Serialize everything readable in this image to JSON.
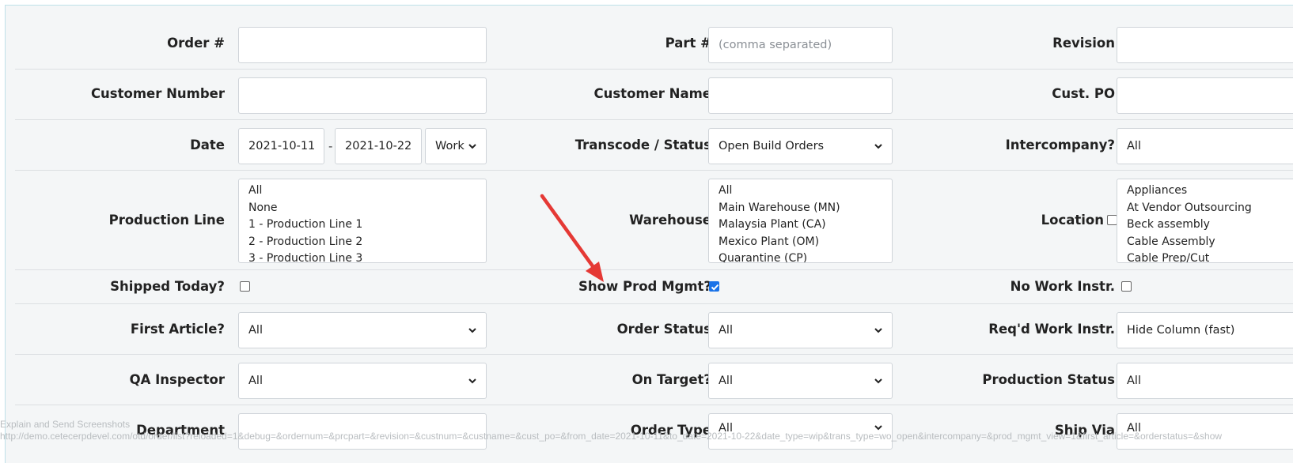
{
  "row1": {
    "order_label": "Order #",
    "part_label": "Part #",
    "part_placeholder": "(comma separated)",
    "revision_label": "Revision"
  },
  "row2": {
    "custnum_label": "Customer Number",
    "custname_label": "Customer Name",
    "custpo_label": "Cust. PO"
  },
  "row3": {
    "date_label": "Date",
    "from_date": "2021-10-11",
    "separator": "-",
    "to_date": "2021-10-22",
    "date_type": "Work",
    "transcode_label": "Transcode / Status",
    "transcode_value": "Open Build Orders",
    "intercompany_label": "Intercompany?",
    "intercompany_value": "All"
  },
  "row4": {
    "prodline_label": "Production Line",
    "prodline_options": [
      "All",
      "None",
      "1 - Production Line 1",
      "2 - Production Line 2",
      "3 - Production Line 3"
    ],
    "warehouse_label": "Warehouse",
    "warehouse_options": [
      "All",
      "Main Warehouse (MN)",
      "Malaysia Plant (CA)",
      "Mexico Plant (OM)",
      "Quarantine (CP)"
    ],
    "location_label": "Location",
    "location_options": [
      "Appliances",
      "At Vendor Outsourcing",
      "Beck assembly",
      "Cable Assembly",
      "Cable Prep/Cut"
    ]
  },
  "row5": {
    "shipped_label": "Shipped Today?",
    "prodmgmt_label": "Show Prod Mgmt?",
    "noworkinstr_label": "No Work Instr."
  },
  "row6": {
    "firstarticle_label": "First Article?",
    "firstarticle_value": "All",
    "orderstatus_label": "Order Status",
    "orderstatus_value": "All",
    "reqwork_label": "Req'd Work Instr.",
    "reqwork_value": "Hide Column (fast)"
  },
  "row7": {
    "qa_label": "QA Inspector",
    "qa_value": "All",
    "ontarget_label": "On Target?",
    "ontarget_value": "All",
    "prodstatus_label": "Production Status",
    "prodstatus_value": "All"
  },
  "row8": {
    "department_label": "Department",
    "ordertype_label": "Order Type",
    "ordertype_value": "All",
    "shipvia_label": "Ship Via",
    "shipvia_value": "All"
  },
  "overlay": {
    "line1": "Explain and Send Screenshots",
    "line2": "http://demo.cetecerpdevel.com/otd/order/list?reloaded=1&debug=&ordernum=&prcpart=&revision=&custnum=&custname=&cust_po=&from_date=2021-10-11&to_date=2021-10-22&date_type=wip&trans_type=wo_open&intercompany=&prod_mgmt_view=1&first_article=&orderstatus=&show"
  },
  "colors": {
    "accent": "#1a73e8",
    "arrow": "#e53935"
  },
  "icons": {
    "caret": "chevron-down-icon",
    "check": "check-icon",
    "arrow": "annotation-arrow-icon"
  }
}
